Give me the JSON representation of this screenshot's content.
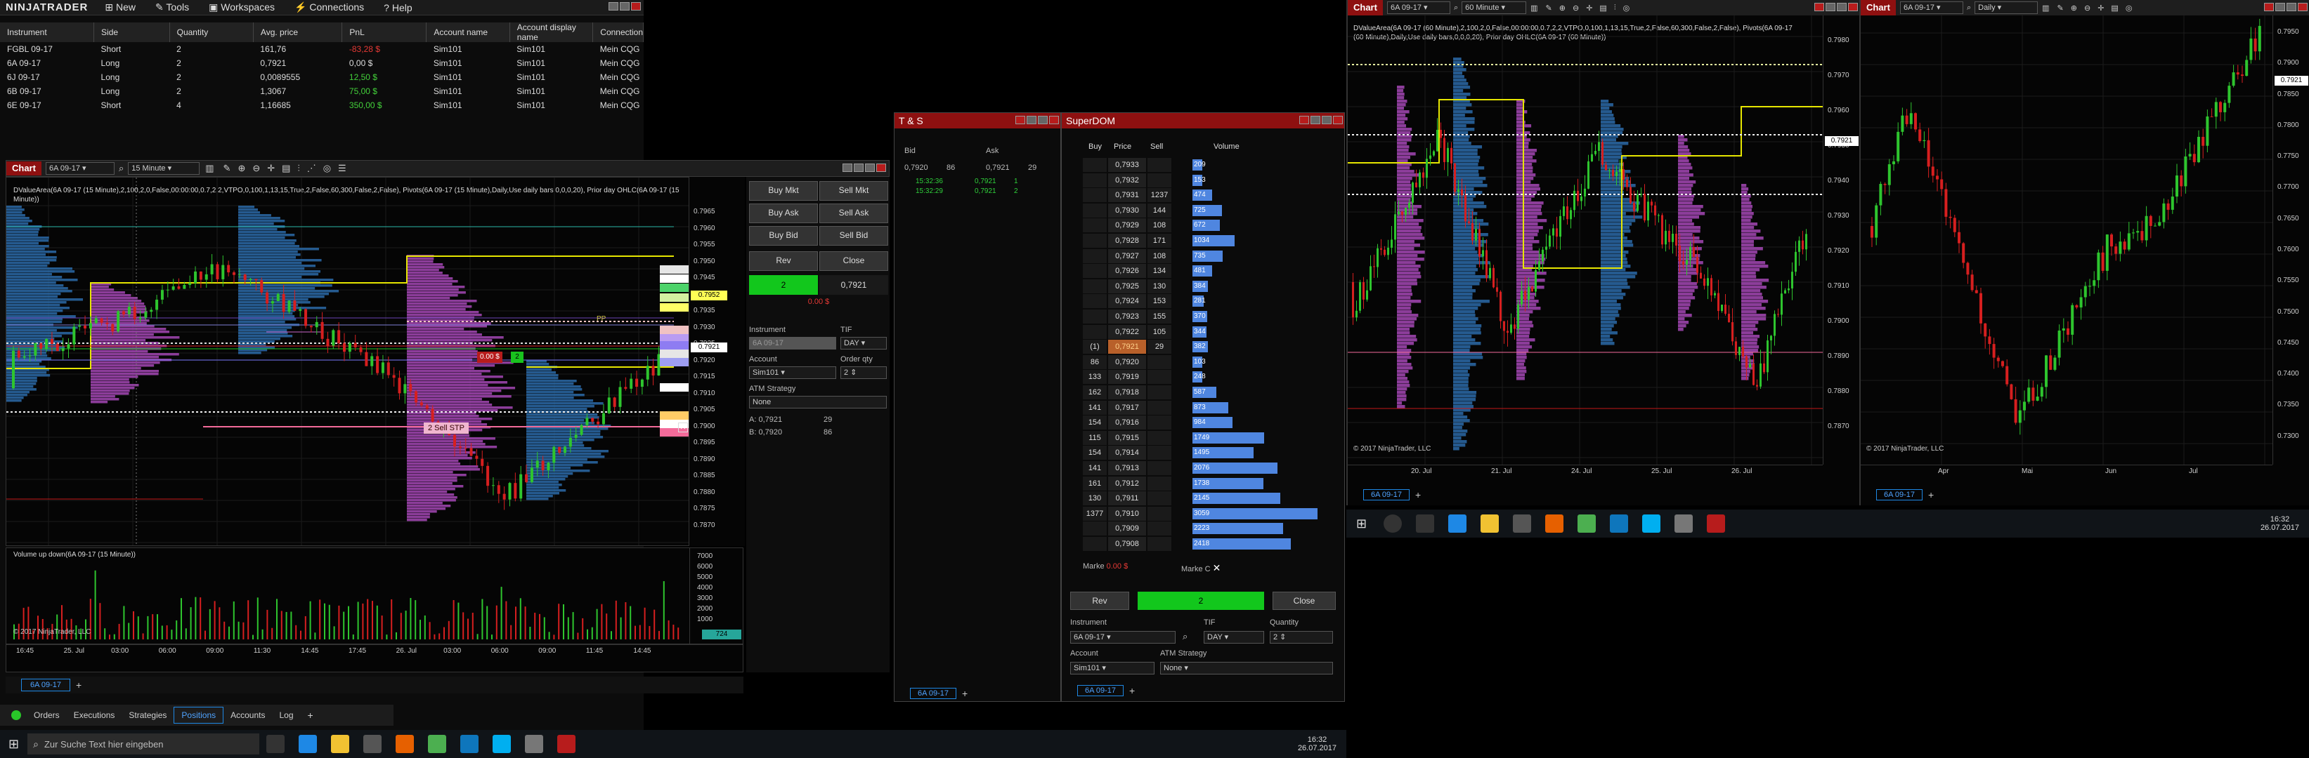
{
  "menu": {
    "logo": "NINJATRADER",
    "items": [
      "New",
      "Tools",
      "Workspaces",
      "Connections",
      "Help"
    ]
  },
  "positions": {
    "columns": [
      "Instrument",
      "Side",
      "Quantity",
      "Avg. price",
      "PnL",
      "Account name",
      "Account display name",
      "Connection"
    ],
    "rows": [
      [
        "FGBL 09-17",
        "Short",
        "2",
        "161,76",
        "-83,28 $",
        "Sim101",
        "Sim101",
        "Mein CQG"
      ],
      [
        "6A 09-17",
        "Long",
        "2",
        "0,7921",
        "0,00 $",
        "Sim101",
        "Sim101",
        "Mein CQG"
      ],
      [
        "6J 09-17",
        "Long",
        "2",
        "0,0089555",
        "12,50 $",
        "Sim101",
        "Sim101",
        "Mein CQG"
      ],
      [
        "6B 09-17",
        "Long",
        "2",
        "1,3067",
        "75,00 $",
        "Sim101",
        "Sim101",
        "Mein CQG"
      ],
      [
        "6E 09-17",
        "Short",
        "4",
        "1,16685",
        "350,00 $",
        "Sim101",
        "Sim101",
        "Mein CQG"
      ]
    ],
    "pnl_colors": [
      "#e53935",
      "#dddddd",
      "#43d13a",
      "#43d13a",
      "#43d13a"
    ]
  },
  "chart1": {
    "title": "Chart",
    "instrument": "6A 09-17",
    "interval": "15 Minute",
    "indicator_text": "DValueArea(6A 09-17 (15 Minute),2,100,2,0,False,00:00:00,0.7,2,2,VTPO,0,100,1,13,15,True,2,False,60,300,False,2,False), Pivots(6A 09-17 (15 Minute),Daily,Use daily bars,0,0,0,20), Prior day OHLC(6A 09-17 (15 Minute))",
    "volume_label": "Volume up down(6A 09-17 (15 Minute))",
    "copyright": "© 2017 NinjaTrader, LLC",
    "price_axis": [
      "0.7965",
      "0.7960",
      "0.7955",
      "0.7950",
      "0.7945",
      "0.7940",
      "0.7935",
      "0.7930",
      "0.7925",
      "0.7920",
      "0.7915",
      "0.7910",
      "0.7905",
      "0.7900",
      "0.7895",
      "0.7890",
      "0.7885",
      "0.7880",
      "0.7875",
      "0.7870"
    ],
    "vol_axis": [
      "7000",
      "6000",
      "5000",
      "4000",
      "3000",
      "2000",
      "1000"
    ],
    "time_axis": [
      "16:45",
      "25. Jul",
      "03:00",
      "06:00",
      "09:00",
      "11:30",
      "14:45",
      "17:45",
      "26. Jul",
      "03:00",
      "06:00",
      "09:00",
      "11:45",
      "14:45"
    ],
    "labels": {
      "last_price": "0.7921",
      "pnl_tag": "0.00 $",
      "order_tag": "2",
      "stop_label": "2  Sell STP",
      "vol_value": "724",
      "pp": "PP",
      "yellow_value": "0.7952"
    },
    "tab": "6A 09-17"
  },
  "chart_trader": {
    "buy_mkt": "Buy Mkt",
    "sell_mkt": "Sell Mkt",
    "buy_ask": "Buy Ask",
    "sell_ask": "Sell Ask",
    "buy_bid": "Buy Bid",
    "sell_bid": "Sell Bid",
    "rev": "Rev",
    "close": "Close",
    "position_qty": "2",
    "position_price": "0,7921",
    "pnl": "0.00 $",
    "instrument_label": "Instrument",
    "instrument_value": "6A 09-17",
    "tif_label": "TIF",
    "tif_value": "DAY",
    "account_label": "Account",
    "account_value": "Sim101",
    "order_qty_label": "Order qty",
    "order_qty_value": "2",
    "atm_label": "ATM Strategy",
    "atm_value": "None",
    "ask_label": "A:",
    "ask_price": "0,7921",
    "ask_size": "29",
    "bid_label": "B:",
    "bid_price": "0,7920",
    "bid_size": "86"
  },
  "ts": {
    "title": "T & S",
    "bid_label": "Bid",
    "ask_label": "Ask",
    "bid_price": "0,7920",
    "bid_size": "86",
    "ask_price": "0,7921",
    "ask_size": "29",
    "rows": [
      [
        "15:32:36",
        "0,7921",
        "1"
      ],
      [
        "15:32:29",
        "0,7921",
        "2"
      ]
    ],
    "tab": "6A 09-17"
  },
  "superdom": {
    "title": "SuperDOM",
    "columns": [
      "Buy",
      "Price",
      "Sell",
      "Volume"
    ],
    "rows": [
      [
        "",
        "0,7933",
        "",
        "209"
      ],
      [
        "",
        "0,7932",
        "",
        "153"
      ],
      [
        "",
        "0,7931",
        "1237",
        "474"
      ],
      [
        "",
        "0,7930",
        "144",
        "725"
      ],
      [
        "",
        "0,7929",
        "108",
        "672"
      ],
      [
        "",
        "0,7928",
        "171",
        "1034"
      ],
      [
        "",
        "0,7927",
        "108",
        "735"
      ],
      [
        "",
        "0,7926",
        "134",
        "481"
      ],
      [
        "",
        "0,7925",
        "130",
        "384"
      ],
      [
        "",
        "0,7924",
        "153",
        "281"
      ],
      [
        "",
        "0,7923",
        "155",
        "370"
      ],
      [
        "",
        "0,7922",
        "105",
        "344"
      ],
      [
        "(1)",
        "0,7921",
        "29",
        "382"
      ],
      [
        "86",
        "0,7920",
        "",
        "103"
      ],
      [
        "133",
        "0,7919",
        "",
        "248"
      ],
      [
        "162",
        "0,7918",
        "",
        "587"
      ],
      [
        "141",
        "0,7917",
        "",
        "873"
      ],
      [
        "154",
        "0,7916",
        "",
        "984"
      ],
      [
        "115",
        "0,7915",
        "",
        "1749"
      ],
      [
        "154",
        "0,7914",
        "",
        "1495"
      ],
      [
        "141",
        "0,7913",
        "",
        "2076"
      ],
      [
        "161",
        "0,7912",
        "",
        "1738"
      ],
      [
        "130",
        "0,7911",
        "",
        "2145"
      ],
      [
        "1377",
        "0,7910",
        "",
        "3059"
      ],
      [
        "",
        "0,7909",
        "",
        "2223"
      ],
      [
        "",
        "0,7908",
        "",
        "2418"
      ]
    ],
    "market_label_left": "Marke",
    "market_pnl": "0.00 $",
    "market_label_right": "Marke",
    "c_label": "C",
    "rev": "Rev",
    "close": "Close",
    "position_qty": "2",
    "instrument_label": "Instrument",
    "instrument_value": "6A 09-17",
    "tif_label": "TIF",
    "tif_value": "DAY",
    "quantity_label": "Quantity",
    "quantity_value": "2",
    "account_label": "Account",
    "account_value": "Sim101",
    "atm_label": "ATM Strategy",
    "atm_value": "None",
    "tab": "6A 09-17"
  },
  "chart2": {
    "title": "Chart",
    "instrument": "6A 09-17",
    "interval": "60 Minute",
    "indicator_text": "DValueArea(6A 09-17 (60 Minute),2,100,2,0,False,00:00:00,0.7,2,2,VTPO,0,100,1,13,15,True,2,False,60,300,False,2,False), Pivots(6A 09-17 (60 Minute),Daily,Use daily bars,0,0,0,20), Prior day OHLC(6A 09-17 (60 Minute))",
    "price_axis": [
      "0.7980",
      "0.7970",
      "0.7960",
      "0.7950",
      "0.7940",
      "0.7930",
      "0.7920",
      "0.7910",
      "0.7900",
      "0.7890",
      "0.7880",
      "0.7870"
    ],
    "last_price": "0.7921",
    "time_axis": [
      "20. Jul",
      "21. Jul",
      "24. Jul",
      "25. Jul",
      "26. Jul"
    ],
    "copyright": "© 2017 NinjaTrader, LLC",
    "tab": "6A 09-17"
  },
  "chart3": {
    "title": "Chart",
    "instrument": "6A 09-17",
    "interval": "Daily",
    "price_axis": [
      "0.7950",
      "0.7900",
      "0.7850",
      "0.7800",
      "0.7750",
      "0.7700",
      "0.7650",
      "0.7600",
      "0.7550",
      "0.7500",
      "0.7450",
      "0.7400",
      "0.7350",
      "0.7300"
    ],
    "last_price": "0.7921",
    "time_axis": [
      "Apr",
      "Mai",
      "Jun",
      "Jul"
    ],
    "copyright": "© 2017 NinjaTrader, LLC",
    "tab": "6A 09-17"
  },
  "bottom_tabs": [
    "Orders",
    "Executions",
    "Strategies",
    "Positions",
    "Accounts",
    "Log"
  ],
  "taskbar": {
    "search_placeholder": "Zur Suche Text hier eingeben",
    "time": "16:32",
    "date": "26.07.2017"
  },
  "taskbar2": {
    "time": "16:32",
    "date": "26.07.2017"
  },
  "colors": {
    "accent_red": "#8e1010",
    "buy_green": "#0fcf2a",
    "profile_magenta": "#b04bc0",
    "profile_blue": "#2a6db0",
    "volume_bar": "#5b8fe0"
  }
}
